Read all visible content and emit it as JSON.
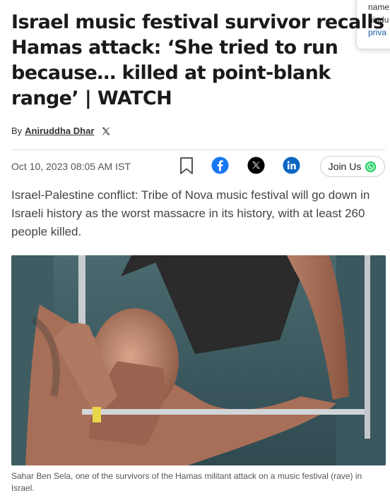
{
  "popup": {
    "line1": "name",
    "line2": "hindu",
    "line3": "priva"
  },
  "article": {
    "headline": "Israel music festival survivor recalls Hamas attack: ‘She tried to run because… killed at point-blank range’ | WATCH",
    "byline_prefix": "By",
    "author": "Aniruddha Dhar",
    "date": "Oct 10, 2023 08:05 AM IST",
    "summary": "Israel-Palestine conflict: Tribe of Nova music festival will go down in Israeli history as the worst massacre in its history, with at least 260 people killed.",
    "caption": "Sahar Ben Sela, one of the survivors of the Hamas militant attack on a music festival (rave) in Israel."
  },
  "share": {
    "join_label": "Join Us"
  },
  "colors": {
    "facebook": "#1877f2",
    "linkedin": "#0a66c2",
    "whatsapp": "#25d366",
    "x": "#000000",
    "link": "#1a5ea8"
  },
  "icons": [
    "x-icon",
    "bookmark-icon",
    "facebook-icon",
    "x-share-icon",
    "linkedin-icon",
    "whatsapp-icon"
  ]
}
